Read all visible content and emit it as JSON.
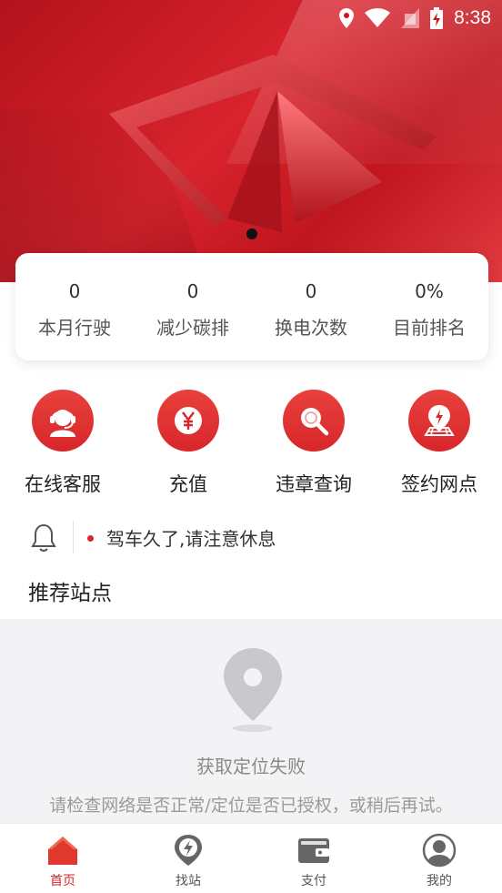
{
  "status_bar": {
    "time": "8:38"
  },
  "banner": {
    "accent": "#d8232d"
  },
  "stats": [
    {
      "value": "0",
      "label": "本月行驶"
    },
    {
      "value": "0",
      "label": "减少碳排"
    },
    {
      "value": "0",
      "label": "换电次数"
    },
    {
      "value": "0%",
      "label": "目前排名"
    }
  ],
  "actions": [
    {
      "label": "在线客服",
      "icon": "headset-icon"
    },
    {
      "label": "充值",
      "icon": "yuan-icon"
    },
    {
      "label": "违章查询",
      "icon": "magnifier-icon"
    },
    {
      "label": "签约网点",
      "icon": "map-pin-icon"
    }
  ],
  "notice": {
    "text": "驾车久了,请注意休息"
  },
  "section": {
    "title": "推荐站点"
  },
  "empty_state": {
    "title": "获取定位失败",
    "message": "请检查网络是否正常/定位是否已授权，或稍后再试。"
  },
  "tabs": [
    {
      "label": "首页",
      "active": true,
      "icon": "home-icon"
    },
    {
      "label": "找站",
      "active": false,
      "icon": "lightning-station-icon"
    },
    {
      "label": "支付",
      "active": false,
      "icon": "wallet-icon"
    },
    {
      "label": "我的",
      "active": false,
      "icon": "profile-icon"
    }
  ],
  "colors": {
    "brand_red": "#d8262b",
    "tab_inactive": "#555555",
    "muted_text": "#8a8a8a"
  }
}
